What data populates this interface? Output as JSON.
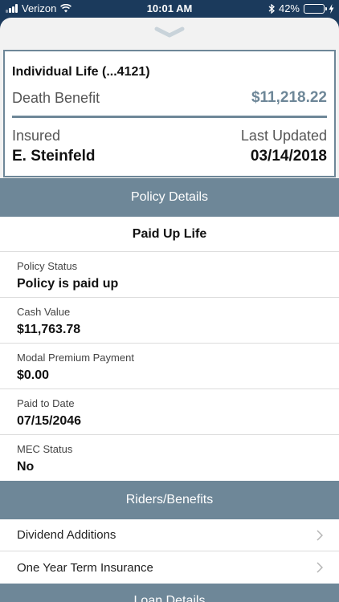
{
  "status_bar": {
    "carrier": "Verizon",
    "time": "10:01 AM",
    "battery_percent": "42%",
    "battery_level": 0.42
  },
  "summary": {
    "plan_name": "Individual Life (...4121)",
    "death_benefit_label": "Death Benefit",
    "death_benefit_value": "$11,218.22",
    "insured_label": "Insured",
    "insured_value": "E. Steinfeld",
    "last_updated_label": "Last Updated",
    "last_updated_value": "03/14/2018"
  },
  "policy_details": {
    "header": "Policy Details",
    "plan_type": "Paid Up Life",
    "fields": [
      {
        "label": "Policy Status",
        "value": "Policy is paid up"
      },
      {
        "label": "Cash Value",
        "value": "$11,763.78"
      },
      {
        "label": "Modal Premium Payment",
        "value": "$0.00"
      },
      {
        "label": "Paid to Date",
        "value": "07/15/2046"
      },
      {
        "label": "MEC Status",
        "value": "No"
      }
    ]
  },
  "riders": {
    "header": "Riders/Benefits",
    "items": [
      {
        "label": "Dividend Additions"
      },
      {
        "label": "One Year Term Insurance"
      }
    ]
  },
  "loan": {
    "header": "Loan Details"
  },
  "colors": {
    "navy": "#1b3a5c",
    "accent": "#6e8798"
  }
}
